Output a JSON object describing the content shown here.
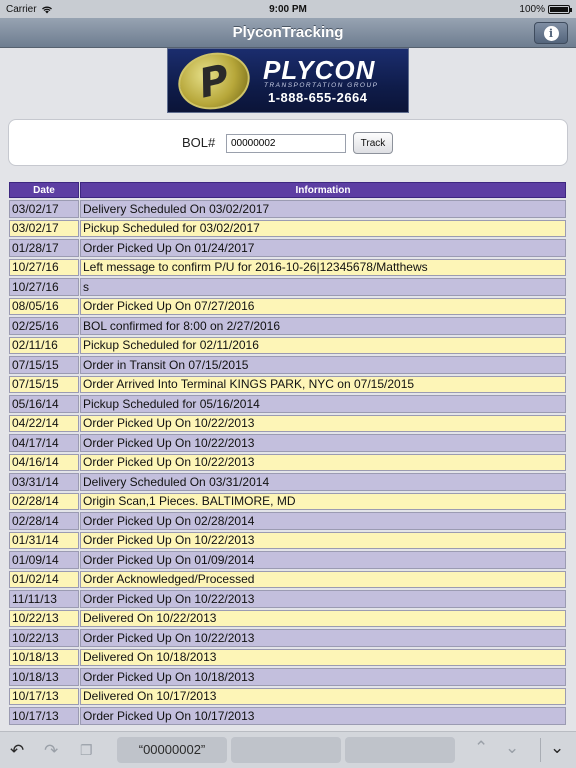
{
  "status_bar": {
    "carrier": "Carrier",
    "time": "9:00 PM",
    "battery": "100%"
  },
  "nav": {
    "title": "PlyconTracking",
    "info_icon": "info-icon"
  },
  "logo": {
    "name": "PLYCON",
    "subtitle": "TRANSPORTATION GROUP",
    "phone": "1-888-655-2664"
  },
  "search": {
    "label": "BOL#",
    "value": "00000002",
    "button_label": "Track"
  },
  "table": {
    "headers": [
      "Date",
      "Information"
    ],
    "rows": [
      {
        "date": "03/02/17",
        "info": "Delivery Scheduled On 03/02/2017",
        "color": "purple"
      },
      {
        "date": "03/02/17",
        "info": "Pickup Scheduled for 03/02/2017",
        "color": "yellow"
      },
      {
        "date": "01/28/17",
        "info": "Order Picked Up On 01/24/2017",
        "color": "purple"
      },
      {
        "date": "10/27/16",
        "info": "Left message to confirm P/U for 2016-10-26|12345678/Matthews",
        "color": "yellow"
      },
      {
        "date": "10/27/16",
        "info": "s",
        "color": "purple"
      },
      {
        "date": "08/05/16",
        "info": "Order Picked Up On 07/27/2016",
        "color": "yellow"
      },
      {
        "date": "02/25/16",
        "info": "BOL confirmed for 8:00 on 2/27/2016",
        "color": "purple"
      },
      {
        "date": "02/11/16",
        "info": "Pickup Scheduled for 02/11/2016",
        "color": "yellow"
      },
      {
        "date": "07/15/15",
        "info": "Order in Transit On 07/15/2015",
        "color": "purple"
      },
      {
        "date": "07/15/15",
        "info": "Order Arrived Into Terminal KINGS PARK, NYC on 07/15/2015",
        "color": "yellow"
      },
      {
        "date": "05/16/14",
        "info": "Pickup Scheduled for 05/16/2014",
        "color": "purple"
      },
      {
        "date": "04/22/14",
        "info": "Order Picked Up On 10/22/2013",
        "color": "yellow"
      },
      {
        "date": "04/17/14",
        "info": "Order Picked Up On 10/22/2013",
        "color": "purple"
      },
      {
        "date": "04/16/14",
        "info": "Order Picked Up On 10/22/2013",
        "color": "yellow"
      },
      {
        "date": "03/31/14",
        "info": "Delivery Scheduled On 03/31/2014",
        "color": "purple"
      },
      {
        "date": "02/28/14",
        "info": "Origin Scan,1 Pieces. BALTIMORE, MD",
        "color": "yellow"
      },
      {
        "date": "02/28/14",
        "info": "Order Picked Up On 02/28/2014",
        "color": "purple"
      },
      {
        "date": "01/31/14",
        "info": "Order Picked Up On 10/22/2013",
        "color": "yellow"
      },
      {
        "date": "01/09/14",
        "info": "Order Picked Up On 01/09/2014",
        "color": "purple"
      },
      {
        "date": "01/02/14",
        "info": "Order Acknowledged/Processed",
        "color": "yellow"
      },
      {
        "date": "11/11/13",
        "info": "Order Picked Up On 10/22/2013",
        "color": "purple"
      },
      {
        "date": "10/22/13",
        "info": "Delivered On 10/22/2013",
        "color": "yellow"
      },
      {
        "date": "10/22/13",
        "info": "Order Picked Up On 10/22/2013",
        "color": "purple"
      },
      {
        "date": "10/18/13",
        "info": "Delivered On 10/18/2013",
        "color": "yellow"
      },
      {
        "date": "10/18/13",
        "info": "Order Picked Up On 10/18/2013",
        "color": "purple"
      },
      {
        "date": "10/17/13",
        "info": "Delivered On 10/17/2013",
        "color": "yellow"
      },
      {
        "date": "10/17/13",
        "info": "Order Picked Up On 10/17/2013",
        "color": "purple"
      }
    ]
  },
  "colors": {
    "purple_row": "#c3bfdd",
    "yellow_row": "#fdf5b7",
    "header": "#5d3fa3"
  },
  "keyboard_bar": {
    "suggestion": "“00000002”",
    "icons": [
      "undo-icon",
      "redo-icon",
      "paste-icon",
      "previous-field-icon",
      "next-field-icon",
      "dismiss-keyboard-icon"
    ]
  }
}
